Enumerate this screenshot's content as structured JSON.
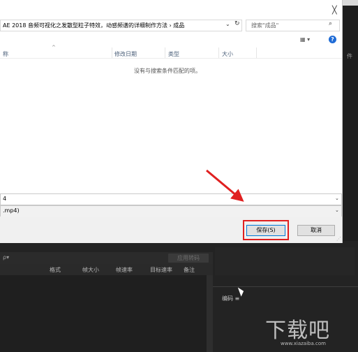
{
  "dialog": {
    "address_path": "AE 2018 音频可视化之发散型粒子特效，动感频谱的详细制作方法 › 成品",
    "search_placeholder": "搜索\"成品\"",
    "columns": [
      "称",
      "修改日期",
      "类型",
      "大小"
    ],
    "empty_message": "没有与搜索条件匹配的项。",
    "filename_value": "4",
    "filetype_value": ".mp4)",
    "save_label": "保存(S)",
    "cancel_label": "取消",
    "close_glyph": "╳"
  },
  "background_app": {
    "right_panel_fragment": "件",
    "apply_label": "应用转码",
    "search_glyph": "ρ▾",
    "columns": [
      "格式",
      "帧大小",
      "帧速率",
      "目标速率",
      "备注"
    ],
    "encode_label": "编码"
  },
  "watermark": {
    "logo_text": "下载吧",
    "url": "www.xiazaiba.com"
  },
  "colors": {
    "highlight": "#e02020",
    "arrow": "#e02020",
    "primary_button_border": "#0078d7",
    "help_icon": "#1e6bd6"
  }
}
